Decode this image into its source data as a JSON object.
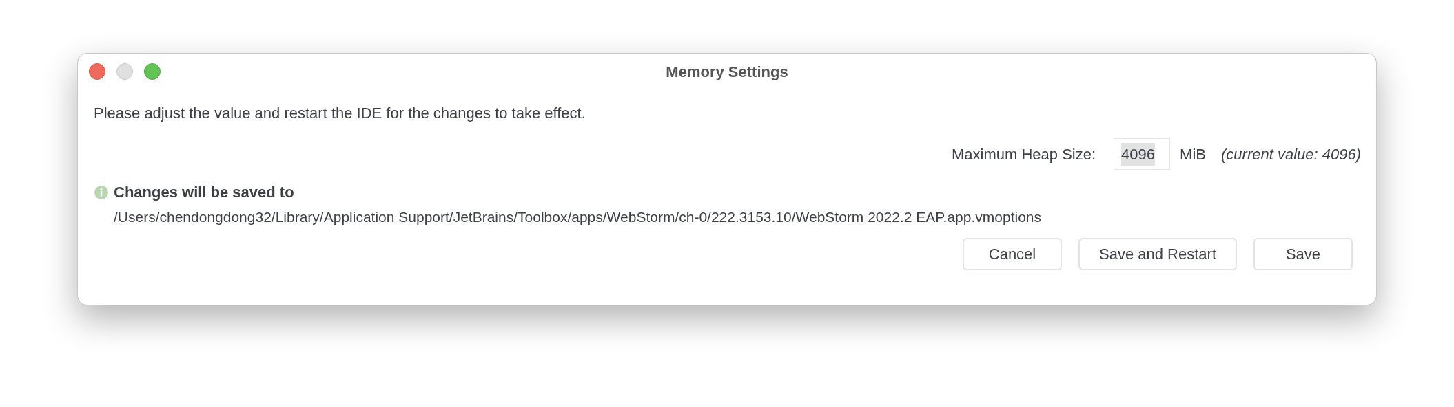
{
  "window": {
    "title": "Memory Settings"
  },
  "message": "Please adjust the value and restart the IDE for the changes to take effect.",
  "heap": {
    "label": "Maximum Heap Size:",
    "value": "4096",
    "unit": "MiB",
    "current": "(current value: 4096)"
  },
  "notice": {
    "title": "Changes will be saved to",
    "path": "/Users/chendongdong32/Library/Application Support/JetBrains/Toolbox/apps/WebStorm/ch-0/222.3153.10/WebStorm 2022.2 EAP.app.vmoptions"
  },
  "buttons": [
    "Cancel",
    "Save and Restart",
    "Save"
  ]
}
